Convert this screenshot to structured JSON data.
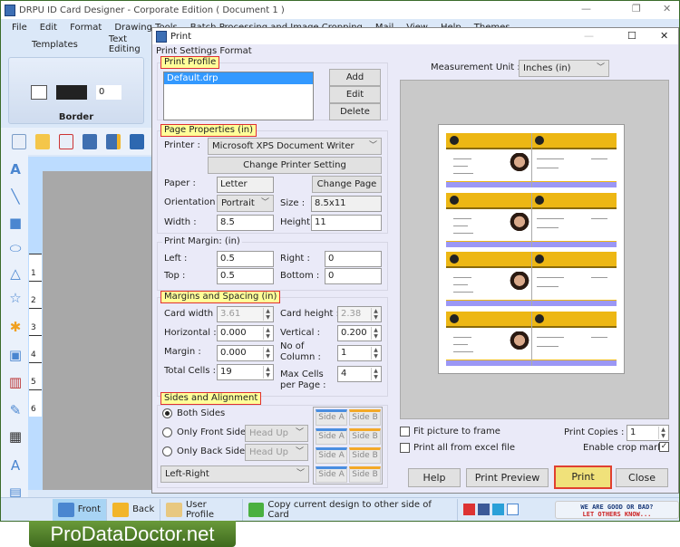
{
  "app": {
    "title": "DRPU ID Card Designer - Corporate Edition ( Document 1 )",
    "menu": [
      "File",
      "Edit",
      "Format",
      "Drawing Tools",
      "Batch Processing and Image Cropping",
      "Mail",
      "View",
      "Help",
      "Themes"
    ],
    "ribbon_tabs": [
      "Templates",
      "Text Editing"
    ],
    "ribbon_group": "Border",
    "border_width": "0",
    "ruler_numbers": [
      "1",
      "2",
      "3",
      "4",
      "5",
      "6"
    ]
  },
  "statusbar": {
    "front": "Front",
    "back": "Back",
    "user_profile": "User Profile",
    "copy_design": "Copy current design to other side of Card",
    "feedback_line1": "WE ARE GOOD OR BAD?",
    "feedback_line2": "LET OTHERS KNOW..."
  },
  "logo": "ProDataDoctor.net",
  "dialog": {
    "title": "Print",
    "section": "Print Settings Format",
    "print_profile": {
      "header": "Print Profile",
      "items": [
        "Default.drp"
      ],
      "add": "Add",
      "edit": "Edit",
      "delete": "Delete"
    },
    "page_properties": {
      "header": "Page Properties  (in)",
      "printer_label": "Printer :",
      "printer": "Microsoft XPS Document Writer",
      "change_printer": "Change Printer Setting",
      "paper_label": "Paper :",
      "paper": "Letter",
      "change_page": "Change Page",
      "orientation_label": "Orientation :",
      "orientation": "Portrait",
      "size_label": "Size :",
      "size": "8.5x11",
      "width_label": "Width :",
      "width": "8.5",
      "height_label": "Height :",
      "height": "11"
    },
    "print_margin": {
      "header": "Print Margin: (in)",
      "left_label": "Left :",
      "left": "0.5",
      "right_label": "Right :",
      "right": "0",
      "top_label": "Top :",
      "top": "0.5",
      "bottom_label": "Bottom :",
      "bottom": "0"
    },
    "margins_spacing": {
      "header": "Margins and Spacing  (in)",
      "card_width_label": "Card width :",
      "card_width": "3.61",
      "card_height_label": "Card height :",
      "card_height": "2.38",
      "horizontal_label": "Horizontal :",
      "horizontal": "0.000",
      "vertical_label": "Vertical :",
      "vertical": "0.200",
      "margin_label": "Margin :",
      "margin": "0.000",
      "columns_label": "No of Column :",
      "columns": "1",
      "total_cells_label": "Total Cells :",
      "total_cells": "19",
      "max_cells_label": "Max Cells per Page :",
      "max_cells": "4"
    },
    "sides": {
      "header": "Sides and Alignment",
      "both": "Both Sides",
      "front_only": "Only Front Side",
      "back_only": "Only Back Side",
      "selected": "Both Sides",
      "front_orient": "Head Up",
      "back_orient": "Head Up",
      "alignment": "Left-Right",
      "side_a": "Side A",
      "side_b": "Side B"
    },
    "measurement_label": "Measurement Unit :",
    "measurement": "Inches (in)",
    "fit_picture": "Fit picture to frame",
    "fit_picture_checked": false,
    "print_excel": "Print all from excel file",
    "print_excel_checked": false,
    "copies_label": "Print Copies :",
    "copies": "1",
    "crop_mark": "Enable crop mark",
    "crop_mark_checked": true,
    "help": "Help",
    "print_preview": "Print Preview",
    "print": "Print",
    "close": "Close",
    "colors": {
      "highlight": "#ffff99",
      "card_band": "#edb714",
      "card_footer": "#9b97f5",
      "selection": "#3399ff"
    }
  }
}
